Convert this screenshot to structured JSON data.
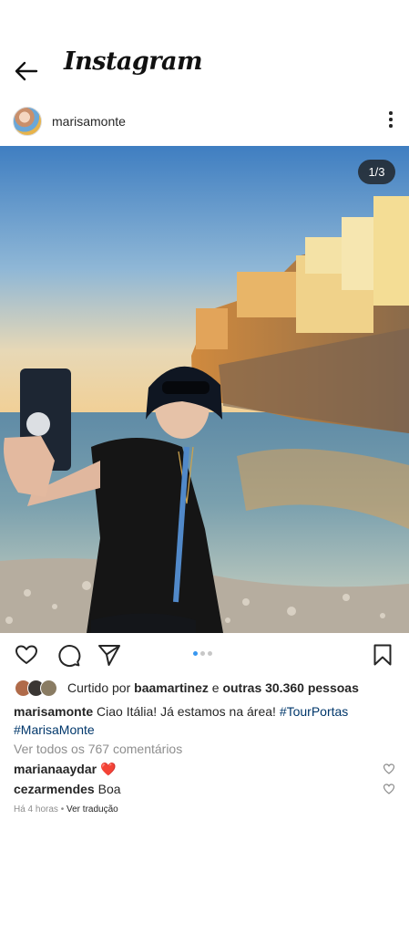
{
  "header": {
    "app_name": "Instagram"
  },
  "post": {
    "username": "marisamonte",
    "image_counter": "1/3",
    "carousel": {
      "count": 3,
      "active_index": 0
    },
    "likes": {
      "prefix": "Curtido por",
      "user": "baamartinez",
      "connector": "e",
      "others": "outras 30.360 pessoas"
    },
    "caption": {
      "username": "marisamonte",
      "text": "Ciao Itália! Já estamos na área!",
      "hashtags": [
        "#TourPortas",
        "#MarisaMonte"
      ]
    },
    "view_all_comments": "Ver todos os 767 comentários",
    "comments": [
      {
        "username": "marianaaydar",
        "text": "❤️"
      },
      {
        "username": "cezarmendes",
        "text": "Boa"
      }
    ],
    "time_ago": "Há 4 horas",
    "separator": "•",
    "see_translation": "Ver tradução"
  },
  "icons": [
    "back-arrow-icon",
    "more-options-icon",
    "heart-icon",
    "comment-icon",
    "share-icon",
    "bookmark-icon"
  ],
  "colors": {
    "hashtag": "#00376b",
    "carousel_active": "#3897f0",
    "muted": "#8e8e8e"
  }
}
